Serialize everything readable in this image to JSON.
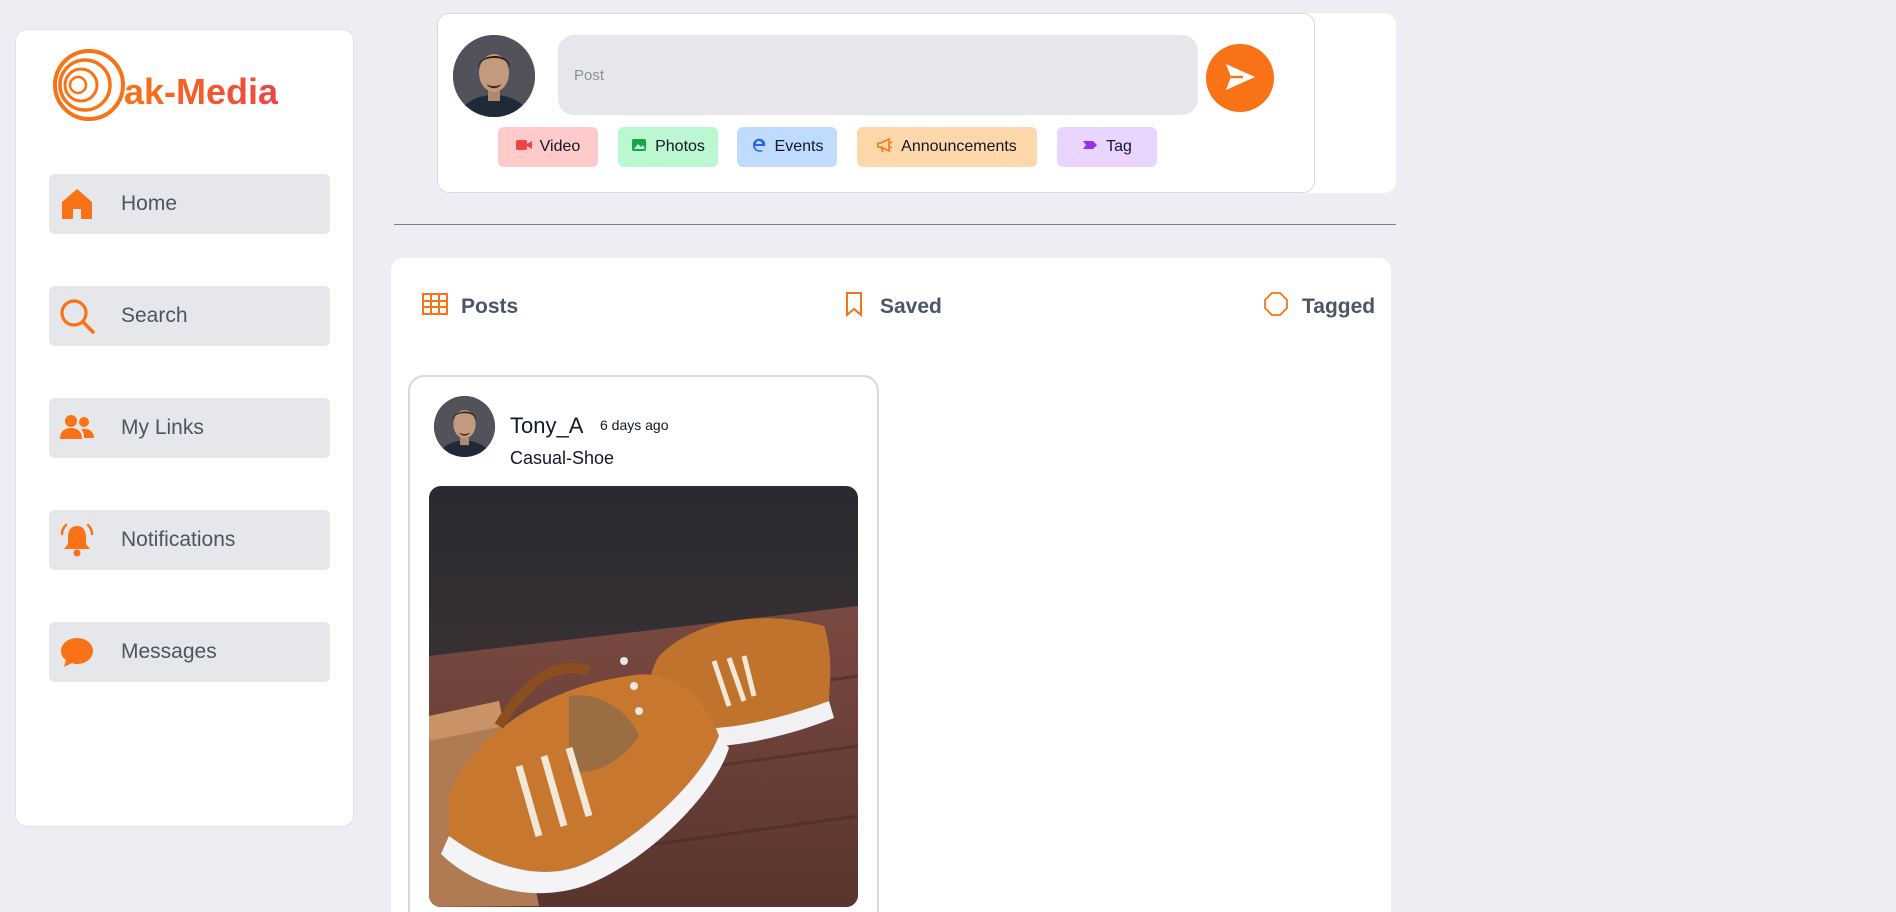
{
  "brand": {
    "name": "ak-Media",
    "accent": "#f97316",
    "accent_end": "#ef4444"
  },
  "sidebar": {
    "items": [
      {
        "label": "Home",
        "icon": "home-icon"
      },
      {
        "label": "Search",
        "icon": "search-icon"
      },
      {
        "label": "My Links",
        "icon": "users-icon"
      },
      {
        "label": "Notifications",
        "icon": "bell-icon"
      },
      {
        "label": "Messages",
        "icon": "chat-bubble-icon"
      }
    ]
  },
  "composer": {
    "placeholder": "Post",
    "value": "",
    "send_icon": "send-icon",
    "chips": [
      {
        "label": "Video",
        "icon": "video-camera-icon",
        "bg": "#fecaca",
        "icon_color": "#ef4444"
      },
      {
        "label": "Photos",
        "icon": "image-icon",
        "bg": "#bbf7d0",
        "icon_color": "#16a34a"
      },
      {
        "label": "Events",
        "icon": "edge-e-icon",
        "bg": "#bfdbfe",
        "icon_color": "#2563eb"
      },
      {
        "label": "Announcements",
        "icon": "megaphone-icon",
        "bg": "#fed7aa",
        "icon_color": "#f97316"
      },
      {
        "label": "Tag",
        "icon": "tag-icon",
        "bg": "#e9d5ff",
        "icon_color": "#9333ea"
      }
    ]
  },
  "profile_tabs": [
    {
      "label": "Posts",
      "icon": "grid-table-icon"
    },
    {
      "label": "Saved",
      "icon": "bookmark-icon"
    },
    {
      "label": "Tagged",
      "icon": "octagon-icon"
    }
  ],
  "posts": [
    {
      "username": "Tony_A",
      "time": "6 days ago",
      "caption": "Casual-Shoe"
    }
  ]
}
